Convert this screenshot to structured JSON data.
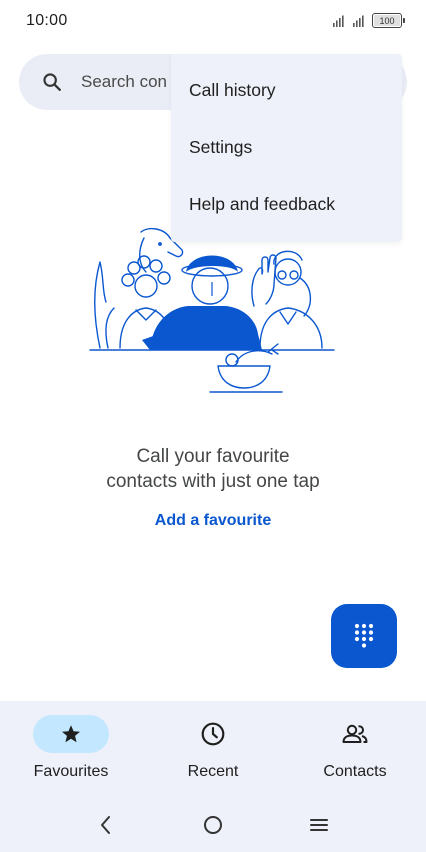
{
  "status_bar": {
    "time": "10:00",
    "battery": "100"
  },
  "search": {
    "placeholder": "Search con"
  },
  "menu": {
    "items": [
      "Call history",
      "Settings",
      "Help and feedback"
    ]
  },
  "empty_state": {
    "line1": "Call your favourite",
    "line2": "contacts with just one tap",
    "action": "Add a favourite"
  },
  "fab": {
    "icon": "dialpad-icon"
  },
  "bottom_nav": {
    "items": [
      {
        "label": "Favourites",
        "icon": "star-icon",
        "active": true
      },
      {
        "label": "Recent",
        "icon": "clock-icon",
        "active": false
      },
      {
        "label": "Contacts",
        "icon": "people-icon",
        "active": false
      }
    ]
  },
  "system_nav": {
    "icons": [
      "back-icon",
      "home-icon",
      "recents-menu-icon"
    ]
  },
  "colors": {
    "accent": "#0b57d0",
    "active_pill": "#c2e7ff",
    "surface": "#eef1f9"
  }
}
